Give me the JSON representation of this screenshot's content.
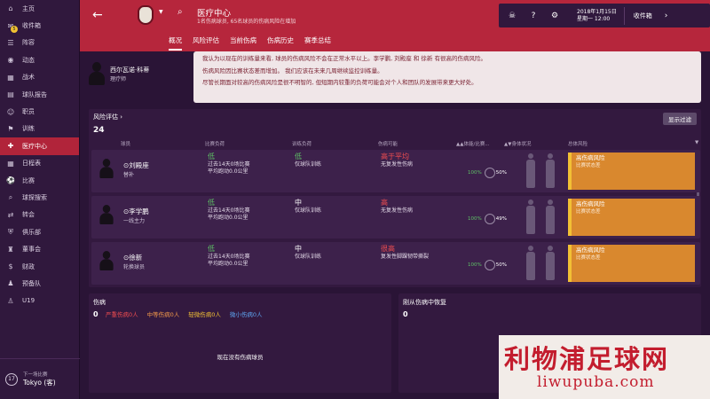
{
  "sidebar": {
    "badge": "5",
    "items": [
      {
        "label": "主页",
        "icon": "home-icon"
      },
      {
        "label": "收件箱",
        "icon": "inbox-icon"
      },
      {
        "label": "阵容",
        "icon": "squad-icon"
      },
      {
        "label": "动态",
        "icon": "news-icon"
      },
      {
        "label": "战术",
        "icon": "tactics-icon"
      },
      {
        "label": "球队报告",
        "icon": "report-icon"
      },
      {
        "label": "职员",
        "icon": "staff-icon"
      },
      {
        "label": "训练",
        "icon": "training-icon"
      },
      {
        "label": "医疗中心",
        "icon": "medical-icon"
      },
      {
        "label": "日程表",
        "icon": "calendar-icon"
      },
      {
        "label": "比赛",
        "icon": "match-icon"
      },
      {
        "label": "球探搜索",
        "icon": "scouting-icon"
      },
      {
        "label": "转会",
        "icon": "transfer-icon"
      },
      {
        "label": "俱乐部",
        "icon": "club-icon"
      },
      {
        "label": "董事会",
        "icon": "board-icon"
      },
      {
        "label": "财政",
        "icon": "finance-icon"
      },
      {
        "label": "预备队",
        "icon": "reserve-icon"
      },
      {
        "label": "U19",
        "icon": "youth-icon"
      }
    ],
    "active_index": 8,
    "next_match": {
      "label": "下一场比赛",
      "date": "17",
      "opponent": "Tokyo (客)"
    }
  },
  "header": {
    "back": "←",
    "title": "医疗中心",
    "subtitle": "1名伤病球员, 65名球员的伤病风险在增加",
    "date_line1": "2018年1月15日",
    "date_line2": "星期一 12:00",
    "inbox": "收件箱",
    "next": "›"
  },
  "tabs": [
    "概况",
    "风险评估",
    "当前伤病",
    "伤病历史",
    "赛季总结"
  ],
  "staff": {
    "name": "西尔瓦诺·科蒂",
    "role": "理疗师"
  },
  "report": [
    "我认为以现在的训练量来看, 球员的伤病风险不会在正常水平以上。李学鹏, 刘殿座 和 徐新 有很高的伤病风险。",
    "伤病风险因比赛状态差而增加。 我们应该在未来几周继续监控训练量。",
    "尽管长期面对较高的伤病风险是很不明智的, 但短期内较重的负荷可能会对个人和团队的发展带来更大好处。"
  ],
  "risk": {
    "title": "风险评估 ›",
    "count": "24",
    "filter": "显示过滤",
    "columns": [
      "球员",
      "比赛负荷",
      "训练负荷",
      "伤病可能",
      "▲▲体能/比赛...",
      "▲▼身体状况",
      "总体风险"
    ],
    "rows": [
      {
        "name": "刘殿座",
        "role": "替补",
        "load": "低",
        "load_sub1": "过去14天0场比赛",
        "load_sub2": "平均跑动0.0公里",
        "train": "低",
        "train_sub": "仅球队训练",
        "poss": "高于平均",
        "poss_sub": "无复发性伤病",
        "fitness": "100%",
        "match": "50%",
        "overall": "高伤病风险",
        "overall_sub": "比赛状态差"
      },
      {
        "name": "李学鹏",
        "role": "一线主力",
        "load": "低",
        "load_sub1": "过去14天0场比赛",
        "load_sub2": "平均跑动0.0公里",
        "train": "中",
        "train_sub": "仅球队训练",
        "poss": "高",
        "poss_sub": "无复发性伤病",
        "fitness": "100%",
        "match": "49%",
        "overall": "高伤病风险",
        "overall_sub": "比赛状态差"
      },
      {
        "name": "徐新",
        "role": "轮换球员",
        "load": "低",
        "load_sub1": "过去14天0场比赛",
        "load_sub2": "平均跑动0.0公里",
        "train": "中",
        "train_sub": "仅球队训练",
        "poss": "很高",
        "poss_sub": "复发性脚踝韧带撕裂",
        "fitness": "100%",
        "match": "50%",
        "overall": "高伤病风险",
        "overall_sub": "比赛状态差"
      }
    ]
  },
  "injuries": {
    "title": "伤病",
    "count": "0",
    "legend": [
      "严重伤病0人",
      "中等伤病0人",
      "轻微伤病0人",
      "微小伤病0人"
    ],
    "empty": "现在没有伤病球员"
  },
  "recovering": {
    "title": "刚从伤病中恢复",
    "count": "0"
  },
  "ad": {
    "text": "利物浦足球网",
    "url": "liwupuba.com"
  },
  "colors": {
    "accent": "#b6263c",
    "sidebar": "#30183d",
    "risk_high": "#d9882e"
  }
}
